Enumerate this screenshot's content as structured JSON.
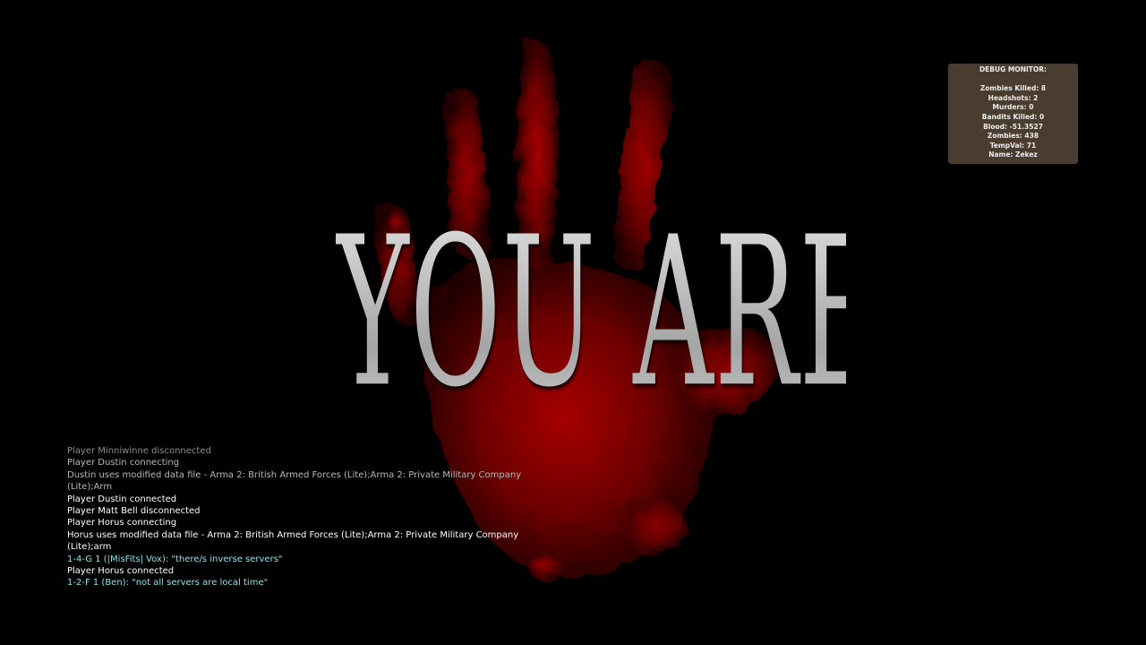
{
  "title": {
    "text": "YOU ARE DEAD"
  },
  "debug_monitor": {
    "header": "DEBUG MONITOR:",
    "lines": [
      "Zombies Killed: 8",
      "Headshots: 2",
      "Murders: 0",
      "Bandits Killed: 0",
      "Blood: -51.3527",
      "Zombies: 438",
      "TempVal: 71",
      "Name: Zekez"
    ]
  },
  "chat_log": {
    "lines": [
      "Player Minniwinne disconnected",
      "Player Dustin connecting",
      "Dustin uses modified data file - Arma 2: British Armed Forces (Lite);Arma 2: Private Military Company",
      "(Lite);Arm",
      "Player Dustin connected",
      "Player Matt Bell disconnected",
      "Player Horus connecting",
      "Horus uses modified data file - Arma 2: British Armed Forces (Lite);Arma 2: Private Military Company",
      "(Lite);arm",
      "1-4-G 1 (|MisFits| Vox): \"there/s inverse servers\"",
      "Player Horus connected",
      "1-2-F 1 (Ben): \"not all servers are local time\""
    ]
  },
  "colors": {
    "background": "#000000",
    "blood": "#8b0000",
    "title": "#d2d2d2",
    "debug_panel": "#4e4032",
    "side_chat": "#8fe1e6",
    "system_chat": "#ffffff"
  }
}
